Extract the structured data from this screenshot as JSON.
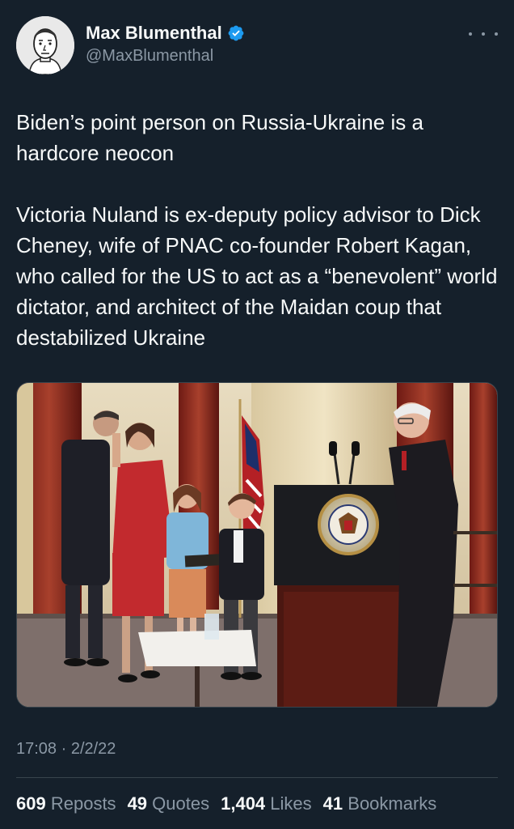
{
  "author": {
    "display_name": "Max Blumenthal",
    "handle": "@MaxBlumenthal",
    "verified": true
  },
  "tweet": {
    "paragraphs": [
      "Biden’s point person on Russia-Ukraine is a hardcore neocon",
      "Victoria Nuland is ex-deputy policy advisor to Dick Cheney, wife of PNAC co-founder Robert Kagan, who called for the US to act as a “benevolent” world dictator, and architect of the Maidan coup that destabilized Ukraine"
    ],
    "timestamp": "17:08 · 2/2/22"
  },
  "media": {
    "seal_text": "VICE PRESIDENT OF THE UNITED STATES"
  },
  "stats": [
    {
      "count": "609",
      "label": "Reposts"
    },
    {
      "count": "49",
      "label": "Quotes"
    },
    {
      "count": "1,404",
      "label": "Likes"
    },
    {
      "count": "41",
      "label": "Bookmarks"
    }
  ],
  "colors": {
    "background": "#15202b",
    "text": "#f7f9f9",
    "secondary": "#8b98a5",
    "verified": "#1d9bf0",
    "divider": "#38444d"
  }
}
